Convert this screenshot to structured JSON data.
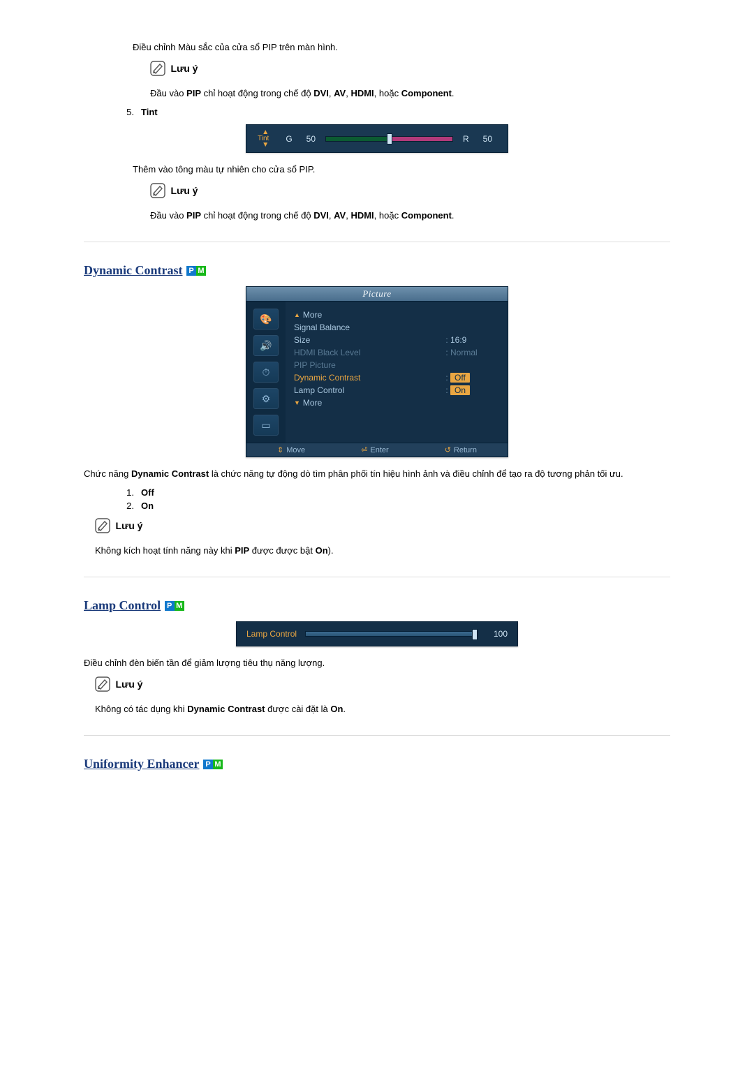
{
  "sections": {
    "pip_color": {
      "body": "Điều chỉnh Màu sắc của cửa sổ PIP trên màn hình.",
      "note_label": "Lưu ý",
      "note_pre": "Đầu vào ",
      "note_bold1": "PIP",
      "note_mid": " chỉ hoạt động trong chế độ ",
      "note_bold2": "DVI",
      "note_sep1": ", ",
      "note_bold3": "AV",
      "note_sep2": ", ",
      "note_bold4": "HDMI",
      "note_sep3": ", hoặc ",
      "note_bold5": "Component",
      "note_end": "."
    },
    "tint": {
      "num": "5.",
      "label": "Tint",
      "osd_label": "Tint",
      "g": "G",
      "gval": "50",
      "r": "R",
      "rval": "50",
      "body": "Thêm vào tông màu tự nhiên cho cửa sổ PIP.",
      "note_label": "Lưu ý",
      "note_pre": "Đầu vào ",
      "note_bold1": "PIP",
      "note_mid": " chỉ hoạt động trong chế độ ",
      "note_bold2": "DVI",
      "note_sep1": ", ",
      "note_bold3": "AV",
      "note_sep2": ", ",
      "note_bold4": "HDMI",
      "note_sep3": ", hoặc ",
      "note_bold5": "Component",
      "note_end": "."
    },
    "dynamic": {
      "heading": "Dynamic Contrast",
      "menu_title": "Picture",
      "more_top": "More",
      "row_sigbal": "Signal Balance",
      "row_size": "Size",
      "row_size_val": "16:9",
      "row_hdmi": "HDMI Black Level",
      "row_hdmi_val": "Normal",
      "row_pip": "PIP Picture",
      "row_dyn": "Dynamic Contrast",
      "row_dyn_val": "Off",
      "row_lamp": "Lamp Control",
      "row_lamp_val": "On",
      "more_bot": "More",
      "foot_move": "Move",
      "foot_enter": "Enter",
      "foot_return": "Return",
      "body_pre": "Chức năng ",
      "body_bold": "Dynamic Contrast",
      "body_post": " là chức năng tự động dò tìm phân phối tín hiệu hình ảnh và điều chỉnh để tạo ra độ tương phản tối ưu.",
      "opt1_n": "1.",
      "opt1": "Off",
      "opt2_n": "2.",
      "opt2": "On",
      "note_label": "Lưu ý",
      "note_pre": "Không kích hoạt tính năng này khi ",
      "note_bold1": "PIP",
      "note_mid": " được được bật ",
      "note_bold2": "On",
      "note_end": ")."
    },
    "lampctrl": {
      "heading": "Lamp Control",
      "osd_label": "Lamp Control",
      "osd_val": "100",
      "body": "Điều chỉnh đèn biến tần để giảm lượng tiêu thụ năng lượng.",
      "note_label": "Lưu ý",
      "note_pre": "Không có tác dụng khi ",
      "note_bold1": "Dynamic Contrast",
      "note_mid": " được cài đặt là ",
      "note_bold2": "On",
      "note_end": "."
    },
    "uniformity": {
      "heading": "Uniformity Enhancer "
    }
  }
}
